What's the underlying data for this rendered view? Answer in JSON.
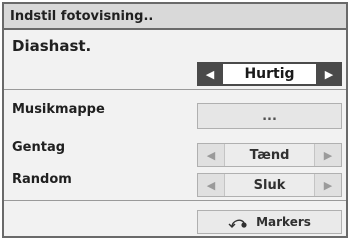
{
  "dialog": {
    "title": "Indstil fotovisning.."
  },
  "rows": {
    "slide_speed": {
      "label": "Diashast.",
      "value": "Hurtig",
      "prev_icon": "triangle-left-icon",
      "next_icon": "triangle-right-icon"
    },
    "music_folder": {
      "label": "Musikmappe",
      "value": "..."
    },
    "repeat": {
      "label": "Gentag",
      "value": "Tænd",
      "prev_icon": "triangle-left-icon",
      "next_icon": "triangle-right-icon"
    },
    "random": {
      "label": "Random",
      "value": "Sluk",
      "prev_icon": "triangle-left-icon",
      "next_icon": "triangle-right-icon"
    }
  },
  "footer": {
    "markers_label": "Markers",
    "markers_icon": "return-arrow-icon"
  },
  "colors": {
    "frame": "#6a6a6a",
    "background": "#f2f2f2",
    "title_bar": "#d9d9d9",
    "active_arrow": "#4a4a4a",
    "inactive_control": "#e8e8e8"
  }
}
